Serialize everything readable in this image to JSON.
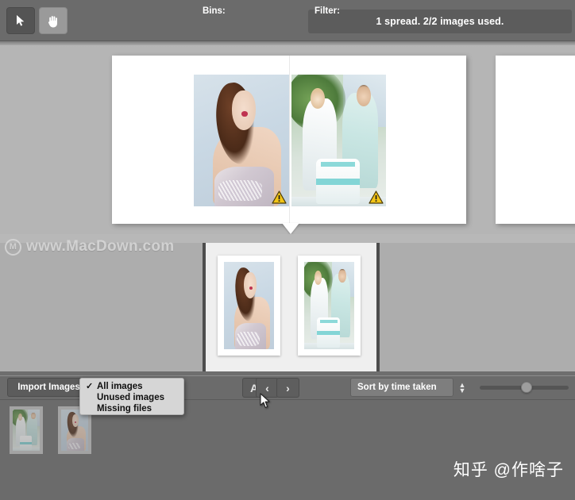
{
  "toolbar": {
    "select_tool_label": "Selection tool",
    "hand_tool_label": "Hand tool",
    "status_text": "1 spread. 2/2 images used."
  },
  "canvas": {
    "spread_warning_1": "!",
    "spread_warning_2": "!"
  },
  "controls": {
    "import_label": "Import Images",
    "import_stepper_up": "▲",
    "import_stepper_down": "▼",
    "bins_label": "Bins:",
    "bins_all_label": "A",
    "bins_prev_label": "‹",
    "bins_next_label": "›",
    "filter_label": "Filter:",
    "filter_value": "Sort by time taken",
    "filter_stepper_up": "▲",
    "filter_stepper_down": "▼",
    "zoom_slider_value": "52"
  },
  "menu": {
    "items": [
      {
        "label": "All images",
        "checked": "✓"
      },
      {
        "label": "Unused images",
        "checked": ""
      },
      {
        "label": "Missing files",
        "checked": ""
      }
    ]
  },
  "watermarks": {
    "macdown_logo": "M",
    "macdown_text": "www.MacDown.com",
    "zhihu_text": "知乎 @作啥子"
  },
  "colors": {
    "toolbar_bg": "#6b6b6b",
    "canvas_bg": "#b5b5b5",
    "strip_bg": "#adadad",
    "strip_center_bg": "#efefef",
    "page_bg": "#ffffff",
    "menu_bg": "#d6d6d6",
    "warning_yellow": "#f2c417",
    "text_light": "#ffffff",
    "text_dark": "#101010"
  }
}
